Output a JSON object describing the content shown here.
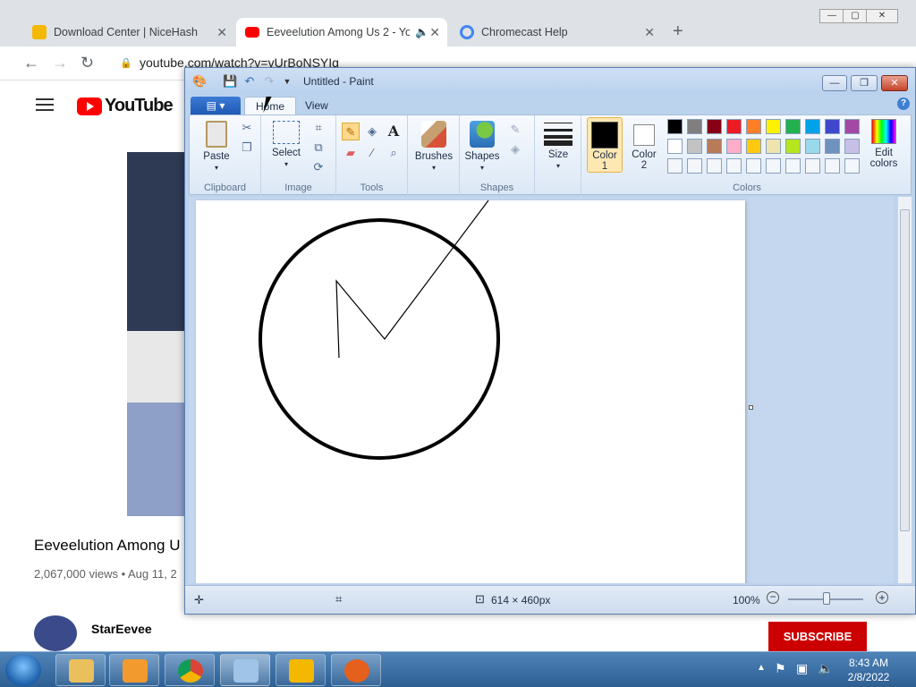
{
  "browser": {
    "tabs": [
      {
        "label": "Download Center | NiceHash",
        "close": "✕"
      },
      {
        "label": "Eeveelution Among Us 2 - Yo",
        "close": "✕"
      },
      {
        "label": "Chromecast Help",
        "close": "✕"
      }
    ],
    "new_tab": "+",
    "url": "youtube.com/watch?v=vUrBoNSYIq"
  },
  "youtube": {
    "logo_text": "YouTube",
    "video_title": "Eeveelution Among U",
    "views": "2,067,000 views • Aug 11, 2",
    "channel": "StarEevee",
    "subscribe": "SUBSCRIBE"
  },
  "paint": {
    "title": "Untitled - Paint",
    "tabs": {
      "home": "Home",
      "view": "View"
    },
    "help": "?",
    "clipboard": {
      "paste": "Paste",
      "group": "Clipboard"
    },
    "image": {
      "select": "Select",
      "group": "Image"
    },
    "tools": {
      "group": "Tools"
    },
    "brushes": {
      "label": "Brushes"
    },
    "shapes": {
      "label": "Shapes",
      "group": "Shapes"
    },
    "size": {
      "label": "Size"
    },
    "color1": {
      "label": "Color",
      "num": "1",
      "value": "#000000"
    },
    "color2": {
      "label": "Color",
      "num": "2",
      "value": "#ffffff"
    },
    "colors": {
      "group": "Colors",
      "edit_label": "Edit",
      "edit_label2": "colors"
    },
    "palette": [
      "#000000",
      "#7f7f7f",
      "#880015",
      "#ed1c24",
      "#ff7f27",
      "#fff200",
      "#22b14c",
      "#00a2e8",
      "#3f48cc",
      "#a349a4",
      "#ffffff",
      "#c3c3c3",
      "#b97a57",
      "#ffaec9",
      "#ffc90e",
      "#efe4b0",
      "#b5e61d",
      "#99d9ea",
      "#7092be",
      "#c8bfe7"
    ],
    "status": {
      "dimensions": "614 × 460px",
      "zoom": "100%"
    }
  },
  "taskbar": {
    "time": "8:43 AM",
    "date": "2/8/2022"
  }
}
